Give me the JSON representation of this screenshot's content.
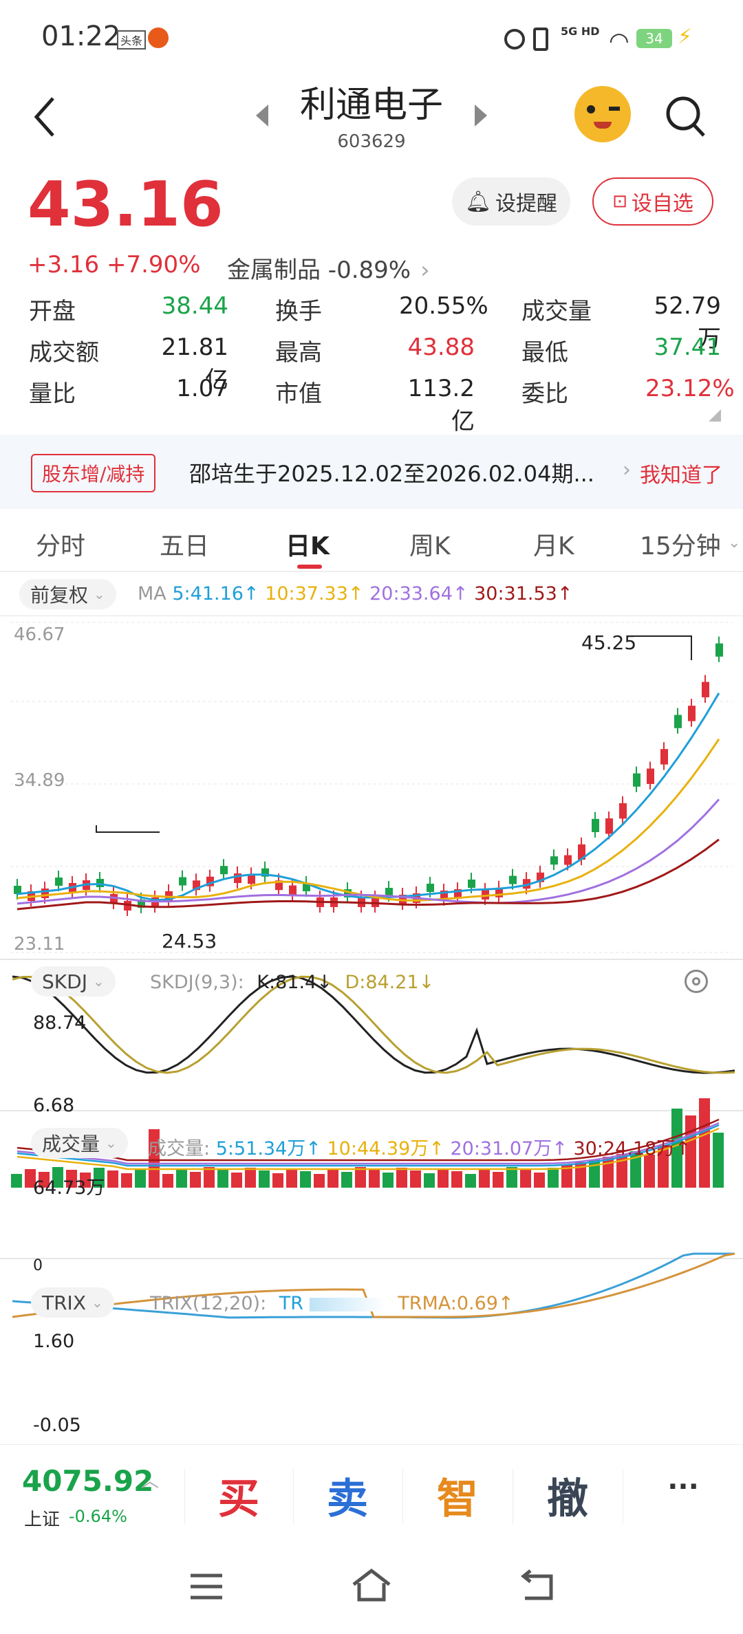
{
  "status": {
    "time": "01:22",
    "app_badge": "头条",
    "network": "5G HD",
    "battery": "34"
  },
  "header": {
    "title": "利通电子",
    "code": "603629"
  },
  "quote": {
    "price": "43.16",
    "change": "+3.16",
    "change_pct": "+7.90%",
    "sector": "金属制品 -0.89%",
    "alert_btn": "设提醒",
    "watch_btn": "设自选",
    "stats": [
      {
        "label": "开盘",
        "value": "38.44"
      },
      {
        "label": "换手",
        "value": "20.55%"
      },
      {
        "label": "成交量",
        "value": "52.79万"
      },
      {
        "label": "成交额",
        "value": "21.81亿"
      },
      {
        "label": "最高",
        "value": "43.88"
      },
      {
        "label": "最低",
        "value": "37.41"
      },
      {
        "label": "量比",
        "value": "1.07"
      },
      {
        "label": "市值",
        "value": "113.2亿"
      },
      {
        "label": "委比",
        "value": "23.12%"
      }
    ]
  },
  "notice": {
    "tag": "股东增/减持",
    "text": "邵培生于2025.12.02至2026.02.04期...",
    "action": "我知道了"
  },
  "tabs": [
    "分时",
    "五日",
    "日K",
    "周K",
    "月K",
    "15分钟"
  ],
  "kline": {
    "adjust": "前复权",
    "ma_label": "MA",
    "ma5": "5:41.16↑",
    "ma10": "10:37.33↑",
    "ma20": "20:33.64↑",
    "ma30": "30:31.53↑",
    "y_top": "46.67",
    "y_mid": "34.89",
    "y_bot": "23.11",
    "high_mark": "45.25",
    "low_mark": "24.53"
  },
  "skdj": {
    "name": "SKDJ",
    "params": "SKDJ(9,3):",
    "k": "K:81.4↓",
    "d": "D:84.21↓",
    "y_top": "88.74",
    "y_bot": "6.68"
  },
  "volume": {
    "name": "成交量",
    "label": "成交量:",
    "v5": "5:51.34万↑",
    "v10": "10:44.39万↑",
    "v20": "20:31.07万↑",
    "v30": "30:24.18万↑",
    "y_top": "64.73万",
    "y_bot": "0"
  },
  "trix": {
    "name": "TRIX",
    "params": "TRIX(12,20):",
    "trix": "TR",
    "trma": "TRMA:0.69↑",
    "y_top": "1.60",
    "y_bot": "-0.05"
  },
  "bottom": {
    "index_val": "4075.92",
    "index_name": "上证",
    "index_chg": "-0.64%",
    "buy": "买",
    "sell": "卖",
    "smart": "智",
    "cancel": "撤",
    "more": "···"
  },
  "colors": {
    "up": "#e0303a",
    "down": "#1aa34a",
    "ma5": "#1e9fd8",
    "ma10": "#e8b10c",
    "ma20": "#a070e0",
    "ma30": "#a01818"
  }
}
